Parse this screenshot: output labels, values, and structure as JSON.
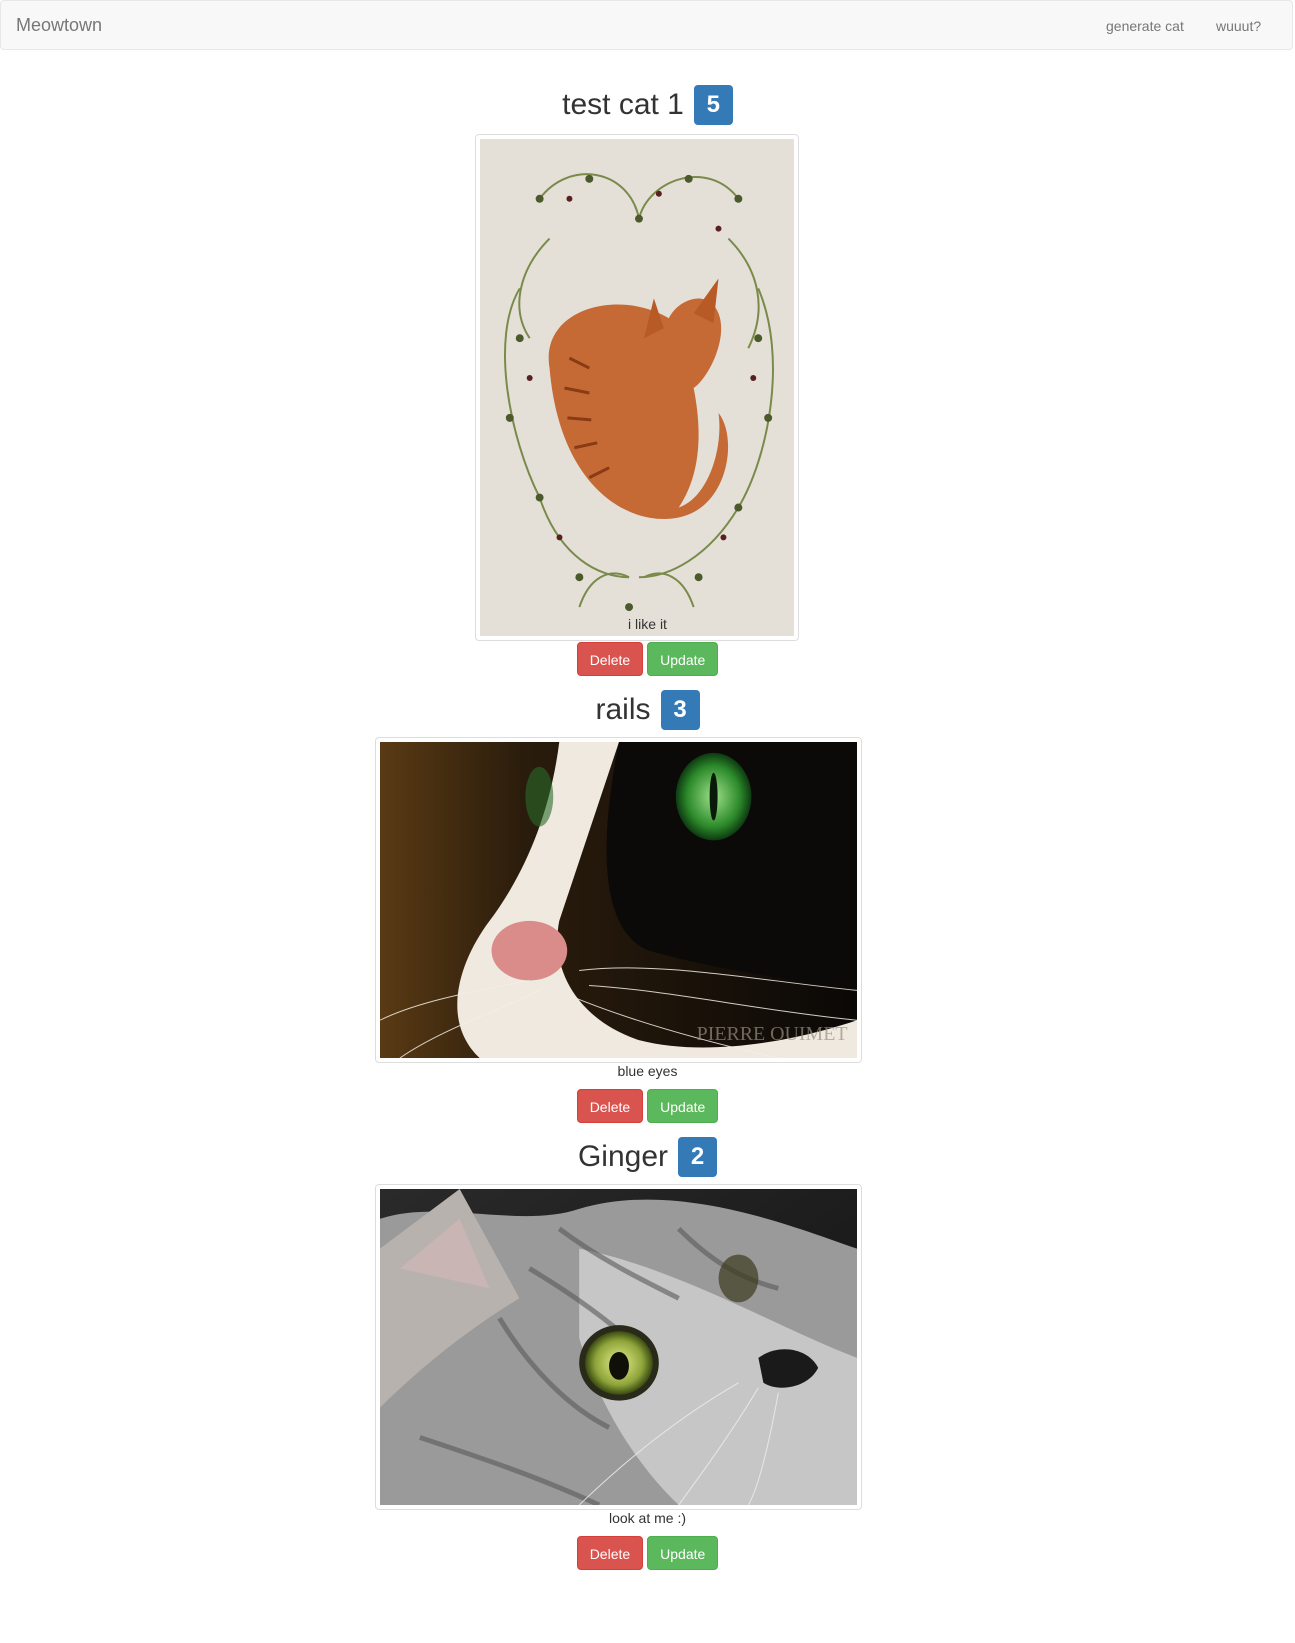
{
  "navbar": {
    "brand": "Meowtown",
    "links": [
      "generate cat",
      "wuuut?"
    ]
  },
  "cats": [
    {
      "name": "test cat 1",
      "votes": "5",
      "caption": "i like it",
      "image": "watercolor-orange-cat-with-vines",
      "delete_label": "Delete",
      "update_label": "Update"
    },
    {
      "name": "rails",
      "votes": "3",
      "caption": "blue eyes",
      "image": "black-white-cat-closeup-green-eye",
      "watermark": "PIERRE OUIMET",
      "delete_label": "Delete",
      "update_label": "Update"
    },
    {
      "name": "Ginger",
      "votes": "2",
      "caption": "look at me :)",
      "image": "grey-tabby-cat-looking-up",
      "delete_label": "Delete",
      "update_label": "Update"
    }
  ]
}
